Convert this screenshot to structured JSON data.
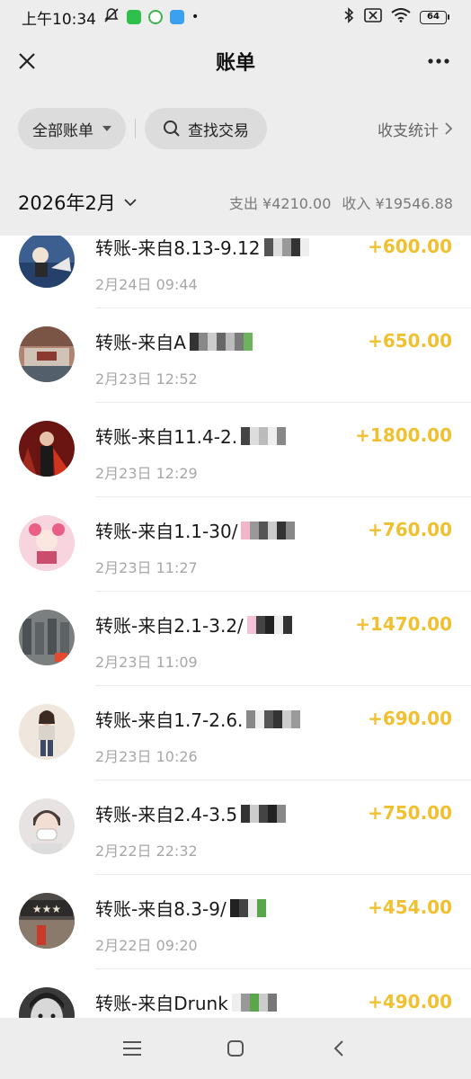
{
  "status_bar": {
    "time": "上午10:34",
    "battery": "64"
  },
  "nav": {
    "title": "账单"
  },
  "filters": {
    "all_bills": "全部账单",
    "search_label": "查找交易",
    "stats_label": "收支统计"
  },
  "month": {
    "label": "2026年2月",
    "expense": "支出 ¥4210.00",
    "income": "收入 ¥19546.88"
  },
  "transactions": [
    {
      "title": "转账-来自8.13-9.12",
      "time": "2月24日 09:44",
      "amount": "+600.00",
      "avatar": "blue-sky-avatar"
    },
    {
      "title": "转账-来自A",
      "time": "2月23日 12:52",
      "amount": "+650.00",
      "avatar": "building-avatar"
    },
    {
      "title": "转账-来自11.4-2.",
      "time": "2月23日 12:29",
      "amount": "+1800.00",
      "avatar": "red-stage-avatar"
    },
    {
      "title": "转账-来自1.1-30/",
      "time": "2月23日 11:27",
      "amount": "+760.00",
      "avatar": "pink-anime-avatar"
    },
    {
      "title": "转账-来自2.1-3.2/",
      "time": "2月23日 11:09",
      "amount": "+1470.00",
      "avatar": "factory-avatar"
    },
    {
      "title": "转账-来自1.7-2.6.",
      "time": "2月23日 10:26",
      "amount": "+690.00",
      "avatar": "fashion-avatar"
    },
    {
      "title": "转账-来自2.4-3.5",
      "time": "2月22日 22:32",
      "amount": "+750.00",
      "avatar": "masked-avatar"
    },
    {
      "title": "转账-来自8.3-9/",
      "time": "2月22日 09:20",
      "amount": "+454.00",
      "avatar": "shop-sign-avatar"
    },
    {
      "title": "转账-来自Drunk",
      "time": "",
      "amount": "+490.00",
      "avatar": "bw-portrait-avatar"
    }
  ],
  "colors": {
    "accent_income": "#f0c030",
    "background_header": "#ededed"
  }
}
